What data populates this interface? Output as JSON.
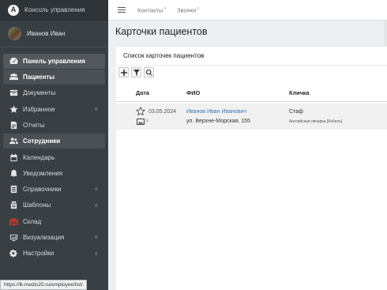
{
  "brand": {
    "logo_letter": "A",
    "title": "Консоль управления"
  },
  "user": {
    "name": "Иванов Иван"
  },
  "sidebar": {
    "items": [
      {
        "label": "Панель управления",
        "icon": "dashboard-icon",
        "state": "active"
      },
      {
        "label": "Пациенты",
        "icon": "patients-icon",
        "state": "highlight"
      },
      {
        "label": "Документы",
        "icon": "documents-icon"
      },
      {
        "label": "Избранное",
        "icon": "star-icon",
        "chevron": "‹"
      },
      {
        "label": "Отчеты",
        "icon": "reports-icon"
      },
      {
        "label": "Сотрудники",
        "icon": "staff-icon",
        "state": "highlight"
      },
      {
        "label": "Календарь",
        "icon": "calendar-icon"
      },
      {
        "label": "Уведомления",
        "icon": "bell-icon"
      },
      {
        "label": "Справочники",
        "icon": "directories-icon",
        "chevron": "‹"
      },
      {
        "label": "Шаблоны",
        "icon": "templates-icon",
        "chevron": "‹"
      },
      {
        "label": "Склад",
        "icon": "warehouse-icon"
      },
      {
        "label": "Визуализация",
        "icon": "visualization-icon",
        "chevron": "‹"
      },
      {
        "label": "Настройки",
        "icon": "settings-icon",
        "chevron": "‹"
      }
    ]
  },
  "topbar": {
    "contacts_label": "Контакты",
    "contacts_count": "0",
    "calls_label": "Звонки",
    "calls_count": "0"
  },
  "page": {
    "title": "Карточки пациентов"
  },
  "box": {
    "title": "Список карточек пациентов"
  },
  "table": {
    "headers": {
      "date": "Дата",
      "fio": "ФИО",
      "pet": "Кличка"
    },
    "rows": [
      {
        "date": "03.05.2024",
        "images_count": "0",
        "fio": "Иванов Иван Иванович",
        "address": "ул. Верхне-Морская, 155",
        "pet": "Стаф",
        "breed": "Английская овчарка [Кобель]"
      }
    ]
  },
  "status_url": "https://lk.medis25.ru/employee/list/",
  "colors": {
    "sidebar_bg": "#3a3f44",
    "link": "#3c75b5",
    "warehouse_icon": "#c0392b"
  }
}
